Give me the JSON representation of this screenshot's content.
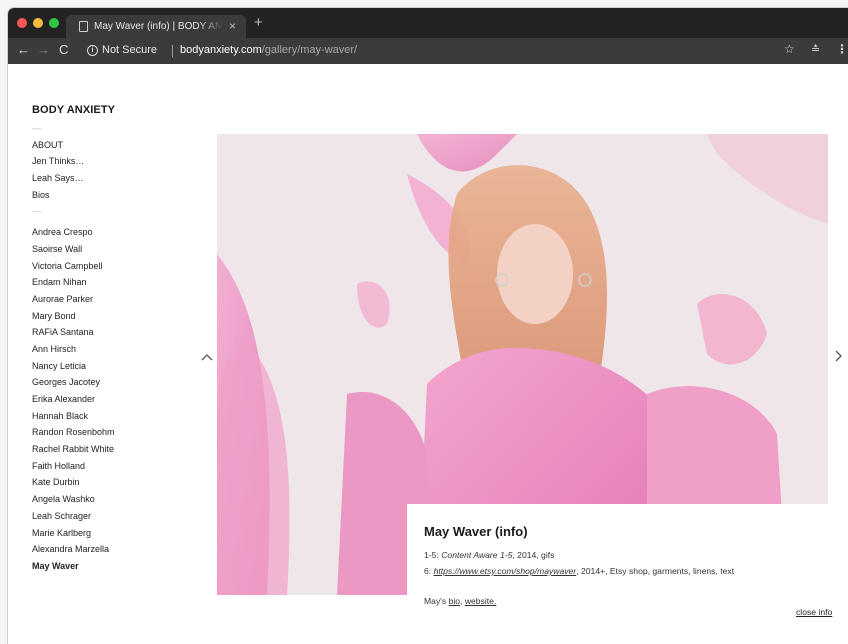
{
  "browser": {
    "tab_title": "May Waver (info) | BODY ANXIETY",
    "tab_close": "×",
    "new_tab": "+",
    "not_secure": "Not Secure",
    "url_host": "bodyanxiety.com",
    "url_path": "/gallery/may-waver/",
    "info_glyph": "i"
  },
  "icons": {
    "back": "←",
    "forward": "→",
    "reload": "C",
    "star": "☆",
    "extension": "≛",
    "menu": "⋮",
    "prev": "‹",
    "next": "›"
  },
  "site": {
    "title": "BODY ANXIETY",
    "dash": "—",
    "menu_items": [
      "ABOUT",
      "Jen Thinks…",
      "Leah Says…",
      "Bios"
    ],
    "artists": [
      "Andrea Crespo",
      "Saoirse Wall",
      "Victoria Campbell",
      "Endam Nihan",
      "Aurorae Parker",
      "Mary Bond",
      "RAFiA Santana",
      "Ann Hirsch",
      "Nancy Leticia",
      "Georges Jacotey",
      "Erika Alexander",
      "Hannah Black",
      "Randon Rosenbohm",
      "Rachel Rabbit White",
      "Faith Holland",
      "Kate Durbin",
      "Angela Washko",
      "Leah Schrager",
      "Marie Karlberg",
      "Alexandra Marzella",
      "May Waver"
    ]
  },
  "info": {
    "title": "May Waver (info)",
    "line1_prefix": "1-5: ",
    "line1_title": "Content Aware 1-5",
    "line1_suffix": ", 2014, gifs",
    "line2_prefix": "6: ",
    "line2_link": "https://www.etsy.com/shop/maywaver",
    "line2_suffix": ", 2014+, Etsy shop, garments, linens, text",
    "line3_prefix": "May's ",
    "bio_link": "bio",
    "line3_mid": ", ",
    "website_link": "website.",
    "close_info": "close info"
  },
  "colors": {
    "accent_pink": "#e58bc0",
    "traffic_red": "#fc5753",
    "traffic_yellow": "#fdbc40",
    "traffic_green": "#33c748"
  }
}
